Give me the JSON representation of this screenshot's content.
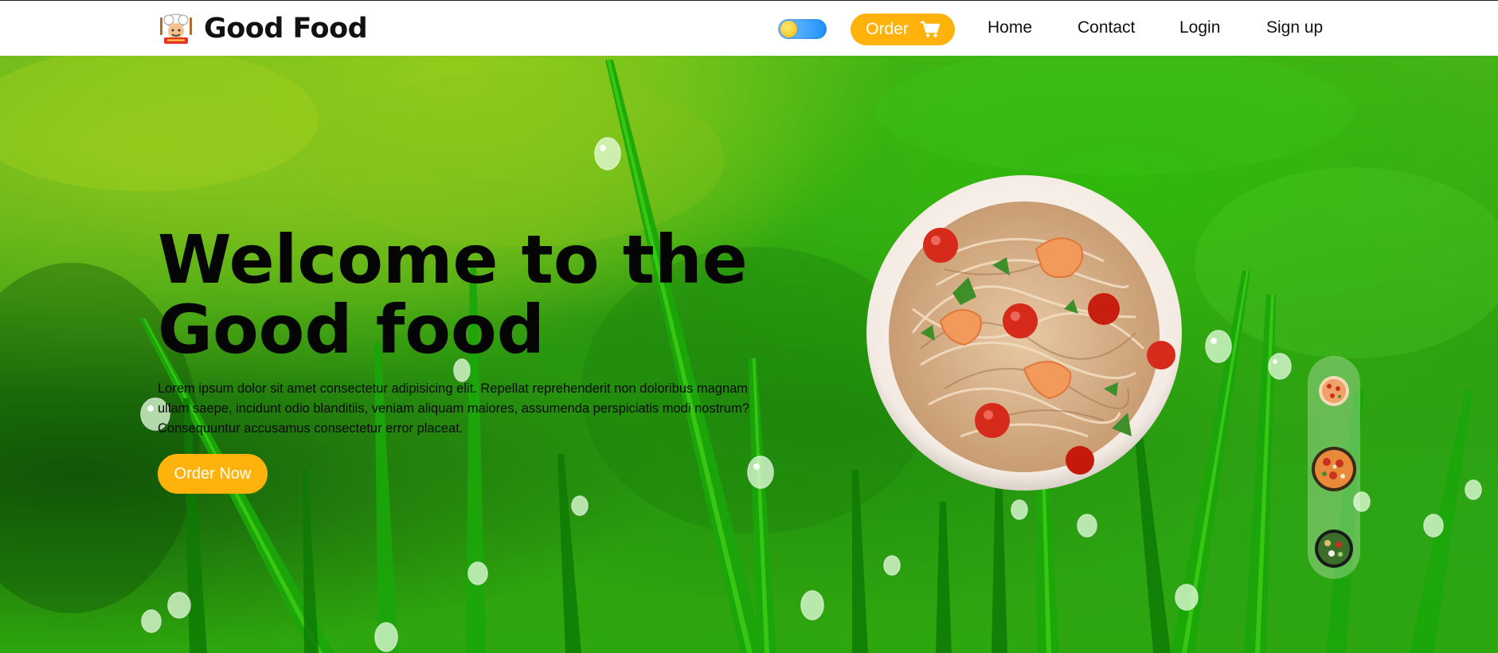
{
  "header": {
    "brand_name": "Good Food",
    "order_label": "Order",
    "nav": [
      "Home",
      "Contact",
      "Login",
      "Sign up"
    ]
  },
  "hero": {
    "title_line1": "Welcome to the",
    "title_line2": "Good food",
    "description": "Lorem ipsum dolor sit amet consectetur adipisicing elit. Repellat reprehenderit non doloribus magnam ullam saepe, incidunt odio blanditiis, veniam aliquam maiores, assumenda perspiciatis modi nostrum? Consequuntur accusamus consectetur error placeat.",
    "cta_label": "Order Now"
  },
  "icons": {
    "logo": "chef-logo-icon",
    "theme": "sun-toggle-icon",
    "cart": "shopping-cart-icon"
  },
  "colors": {
    "accent": "#ffb20b",
    "header_bg": "#ffffff",
    "title": "#050505"
  },
  "thumbnails": [
    "pizza-thumbnail",
    "pizza-veggie-thumbnail",
    "salad-thumbnail"
  ]
}
